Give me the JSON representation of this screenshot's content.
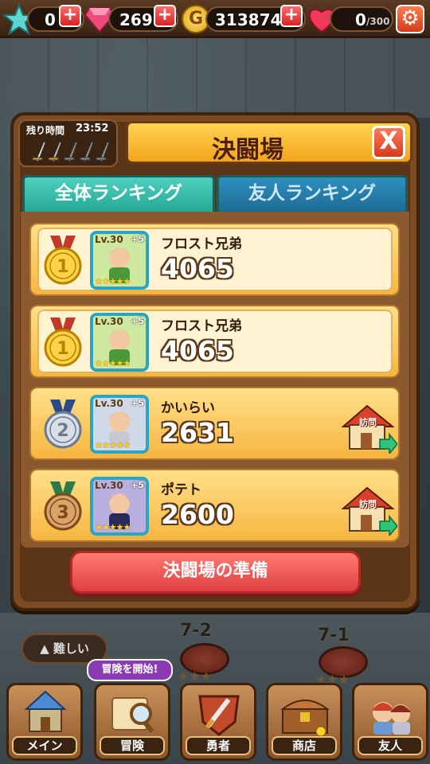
{
  "status_bar": {
    "stars": "0",
    "gems": "269",
    "gold": "313874",
    "hearts": "0",
    "hearts_max": "/300",
    "gold_icon_letter": "G"
  },
  "panel": {
    "timer_label": "残り時間",
    "timer_value": "23:52",
    "title": "決闘場",
    "close_label": "X",
    "tabs": [
      {
        "label": "全体ランキング",
        "active": true
      },
      {
        "label": "友人ランキング",
        "active": false
      }
    ],
    "rows": [
      {
        "rank": "1",
        "level": "Lv.30",
        "plus": "+5",
        "stars": "★★★★★",
        "name": "フロスト兄弟",
        "score": "4065",
        "visit": false
      },
      {
        "rank": "1",
        "level": "Lv.30",
        "plus": "+5",
        "stars": "★★★★★",
        "name": "フロスト兄弟",
        "score": "4065",
        "visit": false
      },
      {
        "rank": "2",
        "level": "Lv.30",
        "plus": "+5",
        "stars": "★★★★★",
        "name": "かいらい",
        "score": "2631",
        "visit": true
      },
      {
        "rank": "3",
        "level": "Lv.30",
        "plus": "+5",
        "stars": "★★★★★",
        "name": "ポテト",
        "score": "2600",
        "visit": true
      }
    ],
    "visit_label": "訪問",
    "prepare_button": "決闘場の準備"
  },
  "map": {
    "difficulty_label": "▲ 難しい",
    "stages": [
      "7-2",
      "7-1"
    ],
    "adventure_bubble": "冒険を開始!"
  },
  "nav": [
    {
      "label": "メイン",
      "icon": "castle-icon"
    },
    {
      "label": "冒険",
      "icon": "map-magnifier-icon"
    },
    {
      "label": "勇者",
      "icon": "sword-shield-icon"
    },
    {
      "label": "商店",
      "icon": "treasure-chest-icon"
    },
    {
      "label": "友人",
      "icon": "friends-icon"
    }
  ],
  "colors": {
    "panel_brown": "#7a4a22",
    "row_gold": "#f6b640",
    "tab_active": "#25a896",
    "tab_inactive": "#1e6c95",
    "prepare_red": "#e04040"
  }
}
